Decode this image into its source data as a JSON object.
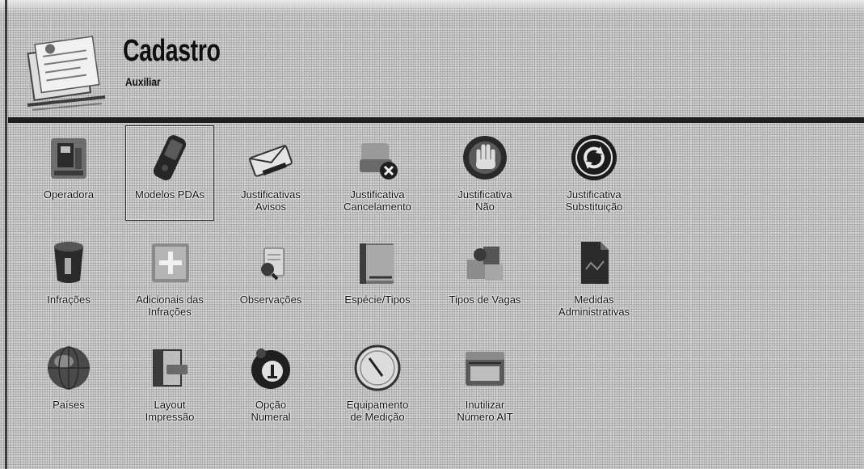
{
  "colors": {
    "background": "#c9c9c9",
    "rule": "#1f1f1f",
    "text": "#0f0f0f"
  },
  "header": {
    "title": "Cadastro",
    "subtitle": "Auxiliar",
    "icon": "register-document-icon"
  },
  "grid": {
    "items": [
      {
        "label": "Operadora",
        "icon": "operator-building-icon"
      },
      {
        "label": "Modelos PDAs",
        "icon": "pda-device-icon"
      },
      {
        "label": "Justificativas\nAvisos",
        "icon": "notice-envelope-icon"
      },
      {
        "label": "Justificativa\nCancelamento",
        "icon": "cancel-document-icon"
      },
      {
        "label": "Justificativa\nNão",
        "icon": "stop-hand-icon"
      },
      {
        "label": "Justificativa\nSubstituição",
        "icon": "refresh-circle-icon"
      },
      {
        "label": "Infrações",
        "icon": "infraction-cup-icon"
      },
      {
        "label": "Adicionais das\nInfrações",
        "icon": "add-map-icon"
      },
      {
        "label": "Observações",
        "icon": "observation-search-icon"
      },
      {
        "label": "Espécie/Tipos",
        "icon": "species-book-icon"
      },
      {
        "label": "Tipos de Vagas",
        "icon": "parking-spaces-icon"
      },
      {
        "label": "Medidas\nAdministrativas",
        "icon": "administrative-document-icon"
      },
      {
        "label": "Países",
        "icon": "globe-icon"
      },
      {
        "label": "Layout\nImpressão",
        "icon": "print-layout-icon"
      },
      {
        "label": "Opção\nNumeral",
        "icon": "numeral-badge-icon"
      },
      {
        "label": "Equipamento\nde Medição",
        "icon": "gauge-icon"
      },
      {
        "label": "Inutilizar\nNúmero AIT",
        "icon": "archive-box-icon"
      }
    ]
  }
}
